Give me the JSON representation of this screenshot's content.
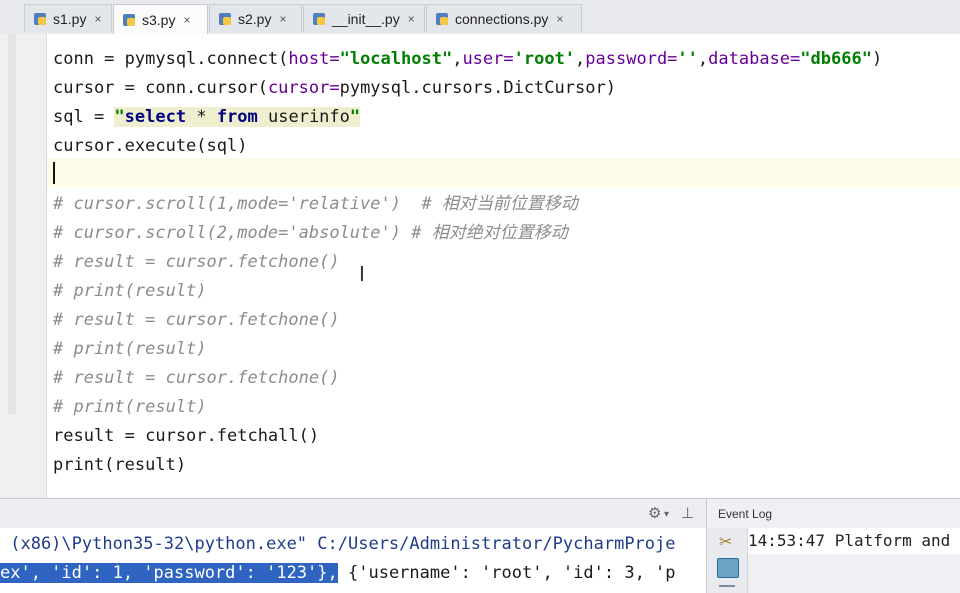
{
  "tabs": [
    {
      "label": "s1.py",
      "active": false
    },
    {
      "label": "s3.py",
      "active": true
    },
    {
      "label": "s2.py",
      "active": false
    },
    {
      "label": "__init__.py",
      "active": false
    },
    {
      "label": "connections.py",
      "active": false
    }
  ],
  "tab_close_symbol": "×",
  "code": {
    "l1": {
      "a": "conn = pymysql.connect(",
      "p1": "host=",
      "s1": "\"localhost\"",
      "c1": ",",
      "p2": "user=",
      "s2": "'root'",
      "c2": ",",
      "p3": "password=",
      "s3": "''",
      "c3": ",",
      "p4": "database=",
      "s4": "\"db666\"",
      "e": ")"
    },
    "l2": {
      "a": "cursor = conn.cursor(",
      "p1": "cursor=",
      "e": "pymysql.cursors.DictCursor)"
    },
    "l3": {
      "a": "sql = ",
      "q1": "\"",
      "k1": "select",
      "m1": " * ",
      "k2": "from",
      "m2": " userinfo",
      "q2": "\""
    },
    "l4": "cursor.execute(sql)",
    "l6": "# cursor.scroll(1,mode='relative')  # 相对当前位置移动",
    "l7": "# cursor.scroll(2,mode='absolute') # 相对绝对位置移动",
    "l8": "# result = cursor.fetchone()",
    "l9": "# print(result)",
    "l10": "# result = cursor.fetchone()",
    "l11": "# print(result)",
    "l12": "# result = cursor.fetchone()",
    "l13": "# print(result)",
    "l14": "result = cursor.fetchall()",
    "l15": "print(result)"
  },
  "console": {
    "line1": " (x86)\\Python35-32\\python.exe\" C:/Users/Administrator/PycharmProje",
    "line2_selected": "ex', 'id': 1, 'password': '123'},",
    "line2_rest": " {'username': 'root', 'id': 3, 'p"
  },
  "toolbar_icons": {
    "settings": "gear-icon",
    "pin": "pin-icon"
  },
  "event_log": {
    "title": "Event Log",
    "message": "14:53:47 Platform and"
  }
}
